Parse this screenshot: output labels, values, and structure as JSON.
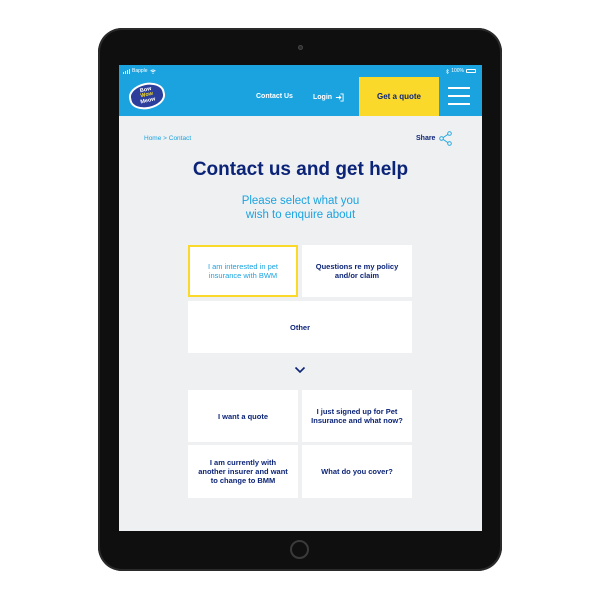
{
  "statusbar": {
    "carrier": "Bapple",
    "battery_label": "100%"
  },
  "brand": {
    "logo_lines": [
      "Bow",
      "Wow",
      "Meow"
    ]
  },
  "header": {
    "contact_label": "Contact Us",
    "login_label": "Login",
    "quote_button_label": "Get a quote"
  },
  "breadcrumb": "Home > Contact",
  "share_label": "Share",
  "page_title": "Contact us and get help",
  "subtitle": {
    "line1": "Please select what you",
    "line2": "wish to enquire about"
  },
  "enquiry_options": [
    {
      "label": "I am interested in pet insurance with BWM",
      "selected": true
    },
    {
      "label": "Questions re my policy and/or claim",
      "selected": false
    },
    {
      "label": "Other",
      "selected": false
    }
  ],
  "follow_up_options": [
    {
      "label": "I want a quote"
    },
    {
      "label": "I just signed up for Pet Insurance and what now?"
    },
    {
      "label": "I am currently with another insurer and want to change to BMM"
    },
    {
      "label": "What do you cover?"
    }
  ],
  "icons": {
    "menu": "hamburger-menu-icon",
    "share": "share-icon",
    "login": "login-arrow-icon",
    "chevron": "chevron-down-icon",
    "wifi": "wifi-icon",
    "bluetooth": "bluetooth-icon",
    "battery": "battery-icon"
  },
  "colors": {
    "brand_blue": "#1ba3e0",
    "navy": "#0c2477",
    "accent_yellow": "#fbd92a",
    "page_background": "#eef0f2"
  }
}
